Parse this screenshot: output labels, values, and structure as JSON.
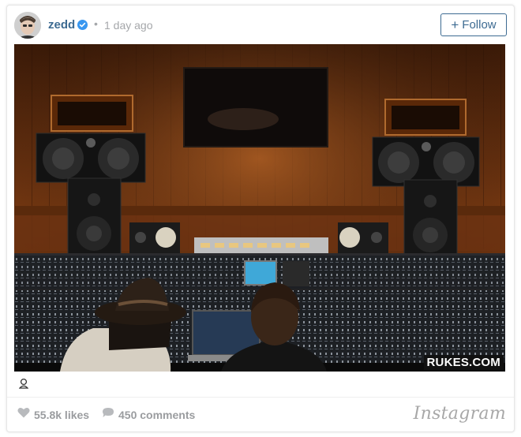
{
  "post": {
    "username": "zedd",
    "separator": "•",
    "time_ago": "1 day ago",
    "follow_label": "Follow",
    "follow_icon": "plus-icon",
    "watermark": "RUKES.COM",
    "likes": "55.8k likes",
    "comments": "450 comments",
    "brand": "Instagram"
  },
  "colors": {
    "link": "#3d6b92",
    "muted": "#a5a7aa",
    "verified": "#3897f0"
  },
  "icons": {
    "verified": "verified-badge-icon",
    "tag": "user-tag-icon",
    "like": "heart-icon",
    "comment": "comment-bubble-icon"
  }
}
